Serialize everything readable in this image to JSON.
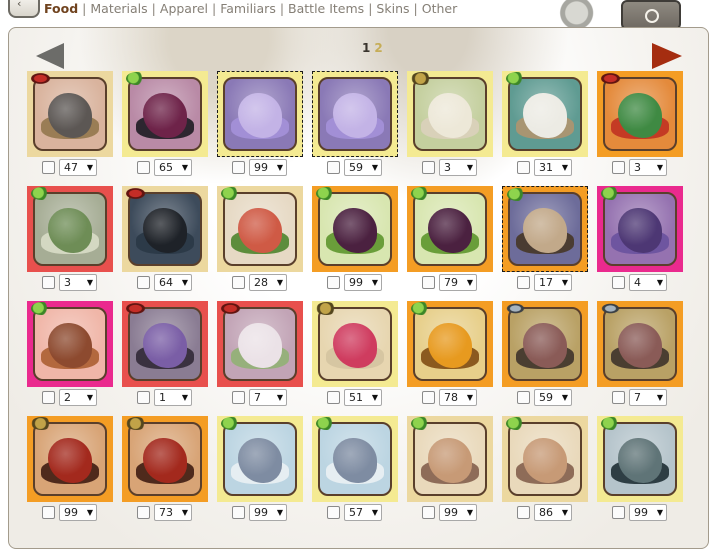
{
  "nav": {
    "back_icon": "chevron-left-icon",
    "back_glyph": "‹",
    "tabs": [
      {
        "label": "Food",
        "active": true
      },
      {
        "label": "Materials",
        "active": false
      },
      {
        "label": "Apparel",
        "active": false
      },
      {
        "label": "Familiars",
        "active": false
      },
      {
        "label": "Battle Items",
        "active": false
      },
      {
        "label": "Skins",
        "active": false
      },
      {
        "label": "Other",
        "active": false
      }
    ],
    "separator": "|"
  },
  "pager": {
    "current": "1",
    "next": "2"
  },
  "colors": {
    "tan_frame": "#ecd89f",
    "yellow_frame": "#f4ea92",
    "orange_frame": "#f49d24",
    "red_frame": "#e8504d",
    "magenta_frame": "#ea2a8e",
    "prev_arrow": "#6c6c69",
    "next_arrow": "#a52d10"
  },
  "items": [
    {
      "qty": "47",
      "frame": "#ecd89f",
      "badge": "meat",
      "bg": "#d9b39d",
      "fig": "#5c5754",
      "fig2": "#9a7d55",
      "selected": false,
      "icon": "sparrow-icon"
    },
    {
      "qty": "65",
      "frame": "#f4ea92",
      "badge": "leaf",
      "bg": "#b98aa6",
      "fig": "#6e2349",
      "fig2": "#2d2630",
      "selected": false,
      "icon": "thistle-icon"
    },
    {
      "qty": "99",
      "frame": "#f4ea92",
      "badge": "",
      "bg": "#8a79b6",
      "fig": "#c3b3e6",
      "fig2": "#a28fd6",
      "selected": true,
      "icon": "clover-icon"
    },
    {
      "qty": "59",
      "frame": "#f4ea92",
      "badge": "",
      "bg": "#8a79b6",
      "fig": "#c3b3e6",
      "fig2": "#a28fd6",
      "selected": true,
      "icon": "clover-icon"
    },
    {
      "qty": "3",
      "frame": "#f4ea92",
      "badge": "bug",
      "bg": "#c4cf9e",
      "fig": "#ede8d8",
      "fig2": "#d9d1b9",
      "selected": false,
      "icon": "moth-icon"
    },
    {
      "qty": "31",
      "frame": "#f4ea92",
      "badge": "leaf",
      "bg": "#5f9b92",
      "fig": "#ecebe4",
      "fig2": "#a89572",
      "selected": false,
      "icon": "grub-icon"
    },
    {
      "qty": "3",
      "frame": "#f49d24",
      "badge": "meat",
      "bg": "#e48a3b",
      "fig": "#3f8a43",
      "fig2": "#c43a24",
      "selected": false,
      "icon": "hummingbird-icon"
    },
    {
      "qty": "3",
      "frame": "#e8504d",
      "badge": "leaf",
      "bg": "#a6ad95",
      "fig": "#6e8d56",
      "fig2": "#d4d8c2",
      "selected": false,
      "icon": "cactus-icon"
    },
    {
      "qty": "64",
      "frame": "#ecd89f",
      "badge": "meat",
      "bg": "#3d4b5b",
      "fig": "#1e2228",
      "fig2": "#2c3a48",
      "selected": false,
      "icon": "rat-icon"
    },
    {
      "qty": "28",
      "frame": "#ecd89f",
      "badge": "leaf",
      "bg": "#e6d9c4",
      "fig": "#cf5a45",
      "fig2": "#5d8d3c",
      "selected": false,
      "icon": "tulip-icon"
    },
    {
      "qty": "99",
      "frame": "#f49d24",
      "badge": "leaf",
      "bg": "#d8e6b0",
      "fig": "#4b2140",
      "fig2": "#6a9e3a",
      "selected": false,
      "icon": "tulip-icon"
    },
    {
      "qty": "79",
      "frame": "#f49d24",
      "badge": "leaf",
      "bg": "#d8e6b0",
      "fig": "#4b2140",
      "fig2": "#6a9e3a",
      "selected": false,
      "icon": "tulip-icon"
    },
    {
      "qty": "17",
      "frame": "#f49d24",
      "badge": "leaf",
      "bg": "#6d6c9a",
      "fig": "#c2a98a",
      "fig2": "#4a3c32",
      "selected": true,
      "icon": "bramble-icon"
    },
    {
      "qty": "4",
      "frame": "#ea2a8e",
      "badge": "leaf",
      "bg": "#9572b0",
      "fig": "#4d3774",
      "fig2": "#6e55a0",
      "selected": false,
      "icon": "pinecone-icon"
    },
    {
      "qty": "2",
      "frame": "#ea2a8e",
      "badge": "leaf",
      "bg": "#f0b6a8",
      "fig": "#8d4a2f",
      "fig2": "#b3683e",
      "selected": false,
      "icon": "pinecone-icon"
    },
    {
      "qty": "1",
      "frame": "#e8504d",
      "badge": "meat",
      "bg": "#8a7c93",
      "fig": "#7a5ea6",
      "fig2": "#3a3140",
      "selected": false,
      "icon": "cobra-icon"
    },
    {
      "qty": "7",
      "frame": "#e8504d",
      "badge": "meat",
      "bg": "#c2a4b6",
      "fig": "#ebe2e7",
      "fig2": "#96b07b",
      "selected": false,
      "icon": "cobra-icon"
    },
    {
      "qty": "51",
      "frame": "#f4ea92",
      "badge": "bug",
      "bg": "#e7d6b0",
      "fig": "#cf3c5f",
      "fig2": "#d6c6a2",
      "selected": false,
      "icon": "butterfly-icon"
    },
    {
      "qty": "78",
      "frame": "#f49d24",
      "badge": "leaf",
      "bg": "#e7cf8a",
      "fig": "#e79a1f",
      "fig2": "#8b5a1f",
      "selected": false,
      "icon": "lily-icon"
    },
    {
      "qty": "59",
      "frame": "#f49d24",
      "badge": "fish",
      "bg": "#b9a165",
      "fig": "#8a5b57",
      "fig2": "#4a3e31",
      "selected": false,
      "icon": "catfish-icon"
    },
    {
      "qty": "7",
      "frame": "#f49d24",
      "badge": "fish",
      "bg": "#b9a165",
      "fig": "#8a5b57",
      "fig2": "#4a3e31",
      "selected": false,
      "icon": "catfish-icon"
    },
    {
      "qty": "99",
      "frame": "#f49d24",
      "badge": "bug",
      "bg": "#d8a476",
      "fig": "#a3291d",
      "fig2": "#4f2a1c",
      "selected": false,
      "icon": "beetle-icon"
    },
    {
      "qty": "73",
      "frame": "#f49d24",
      "badge": "bug",
      "bg": "#d8a476",
      "fig": "#a3291d",
      "fig2": "#4f2a1c",
      "selected": false,
      "icon": "beetle-icon"
    },
    {
      "qty": "99",
      "frame": "#f4ea92",
      "badge": "leaf",
      "bg": "#bcd5e2",
      "fig": "#7e8ca2",
      "fig2": "#e6eef2",
      "selected": false,
      "icon": "bulb-icon"
    },
    {
      "qty": "57",
      "frame": "#f4ea92",
      "badge": "leaf",
      "bg": "#bcd5e2",
      "fig": "#7e8ca2",
      "fig2": "#e6eef2",
      "selected": false,
      "icon": "bulb-icon"
    },
    {
      "qty": "99",
      "frame": "#ecd89f",
      "badge": "leaf",
      "bg": "#e9d9bb",
      "fig": "#c79a76",
      "fig2": "#8e6c58",
      "selected": false,
      "icon": "agave-icon"
    },
    {
      "qty": "86",
      "frame": "#ecd89f",
      "badge": "leaf",
      "bg": "#e9d9bb",
      "fig": "#c79a76",
      "fig2": "#8e6c58",
      "selected": false,
      "icon": "agave-icon"
    },
    {
      "qty": "99",
      "frame": "#f4ea92",
      "badge": "leaf",
      "bg": "#b5c4cb",
      "fig": "#5f7477",
      "fig2": "#2e3e44",
      "selected": false,
      "icon": "agave-icon"
    }
  ]
}
